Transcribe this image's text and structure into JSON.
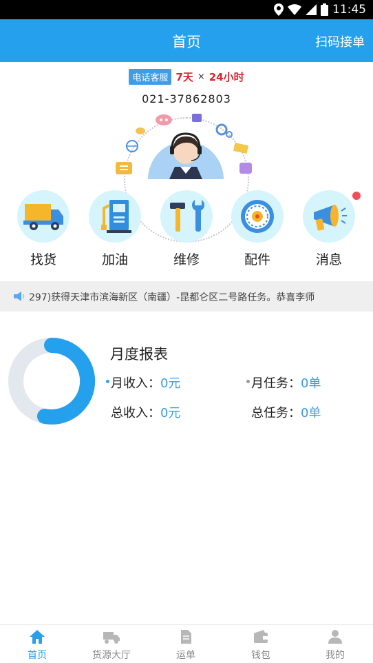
{
  "statusbar": {
    "time": "11:45"
  },
  "header": {
    "title": "首页",
    "scan_label": "扫码接单"
  },
  "service": {
    "tag": "电话客服",
    "hours_days": "7天",
    "hours_times": "×",
    "hours_hours": "24小时",
    "phone": "021-37862803"
  },
  "grid": {
    "items": [
      {
        "label": "找货",
        "icon": "truck-icon"
      },
      {
        "label": "加油",
        "icon": "fuel-pump-icon"
      },
      {
        "label": "维修",
        "icon": "tools-icon"
      },
      {
        "label": "配件",
        "icon": "wheel-icon"
      },
      {
        "label": "消息",
        "icon": "megaphone-icon"
      }
    ]
  },
  "ticker": {
    "text": "297)获得天津市滨海新区（南疆）-昆都仑区二号路任务。恭喜李师"
  },
  "report": {
    "title": "月度报表",
    "month_income_label": "月收入：",
    "month_income_value": "0元",
    "month_tasks_label": "月任务：",
    "month_tasks_value": "0单",
    "total_income_label": "总收入：",
    "total_income_value": "0元",
    "total_tasks_label": "总任务：",
    "total_tasks_value": "0单",
    "colors": {
      "accent": "#25a0ec",
      "track": "#e3e7ee"
    }
  },
  "tabs": [
    {
      "label": "首页",
      "icon": "home-icon",
      "active": true
    },
    {
      "label": "货源大厅",
      "icon": "truck-icon",
      "active": false
    },
    {
      "label": "运单",
      "icon": "document-icon",
      "active": false
    },
    {
      "label": "钱包",
      "icon": "wallet-icon",
      "active": false
    },
    {
      "label": "我的",
      "icon": "person-icon",
      "active": false
    }
  ]
}
